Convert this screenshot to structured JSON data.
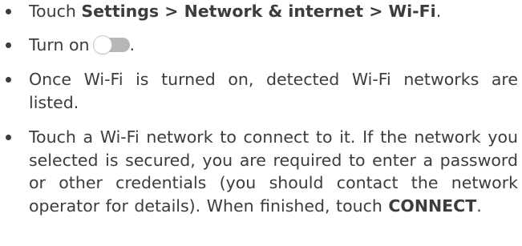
{
  "steps": [
    {
      "prefix": "Touch ",
      "path": "Settings > Network & internet > Wi-Fi",
      "suffix": "."
    },
    {
      "prefix": "Turn on",
      "toggle_icon": "toggle-off-icon",
      "suffix": "."
    },
    {
      "text": "Once Wi-Fi is turned on, detected Wi-Fi networks are listed."
    },
    {
      "prefix": "Touch a Wi-Fi network to connect to it. If the network you selected is secured, you are required to enter a password or other credentials (you should contact the network operator for details). When finished, touch ",
      "emphasis": "CONNECT",
      "suffix": "."
    }
  ],
  "colors": {
    "text": "#3c3c3c",
    "toggle_track": "#b7b7b7",
    "toggle_knob": "#ffffff"
  }
}
